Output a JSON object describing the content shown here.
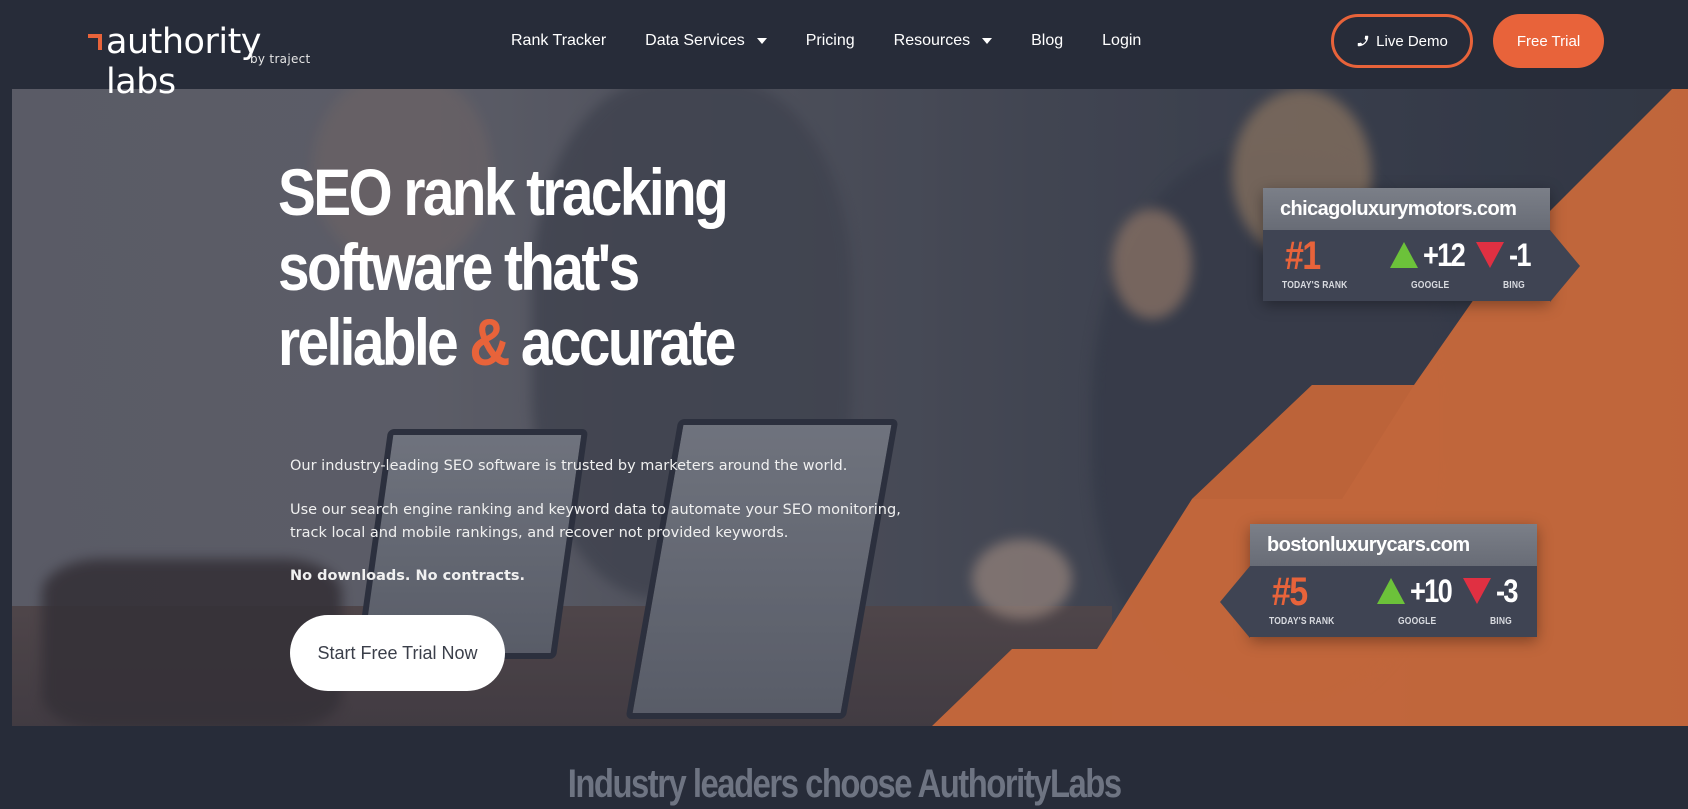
{
  "header": {
    "logo": {
      "wordmark": "authority labs",
      "sub": "by traject"
    },
    "nav": [
      {
        "label": "Rank Tracker",
        "has_dropdown": false
      },
      {
        "label": "Data Services",
        "has_dropdown": true
      },
      {
        "label": "Pricing",
        "has_dropdown": false
      },
      {
        "label": "Resources",
        "has_dropdown": true
      },
      {
        "label": "Blog",
        "has_dropdown": false
      },
      {
        "label": "Login",
        "has_dropdown": false
      }
    ],
    "live_demo": {
      "label": "Live Demo",
      "icon": "phone-icon"
    },
    "free_trial": {
      "label": "Free Trial"
    }
  },
  "hero": {
    "headline": {
      "line1": "SEO rank tracking",
      "line2": "software that's",
      "line3_a": "reliable ",
      "line3_amp": "&",
      "line3_b": " accurate"
    },
    "paragraph1": "Our industry-leading SEO software is trusted by marketers around the world.",
    "paragraph2": "Use our search engine ranking and keyword data to automate your SEO monitoring, track local and mobile rankings, and recover not provided keywords.",
    "paragraph3": "No downloads. No contracts.",
    "cta_label": "Start Free Trial Now",
    "cards": [
      {
        "domain": "chicagoluxurymotors.com",
        "rank": "#1",
        "rank_label": "TODAY'S RANK",
        "google_delta": "+12",
        "google_label": "GOOGLE",
        "bing_delta": "-1",
        "bing_label": "BING"
      },
      {
        "domain": "bostonluxurycars.com",
        "rank": "#5",
        "rank_label": "TODAY'S RANK",
        "google_delta": "+10",
        "google_label": "GOOGLE",
        "bing_delta": "-3",
        "bing_label": "BING"
      }
    ]
  },
  "section": {
    "heading": "Industry leaders choose AuthorityLabs"
  },
  "colors": {
    "brand_orange": "#e8633a",
    "header_bg": "#272c39",
    "hero_orange": "#c8683b",
    "up_green": "#6cc23a",
    "down_red": "#e03042"
  }
}
